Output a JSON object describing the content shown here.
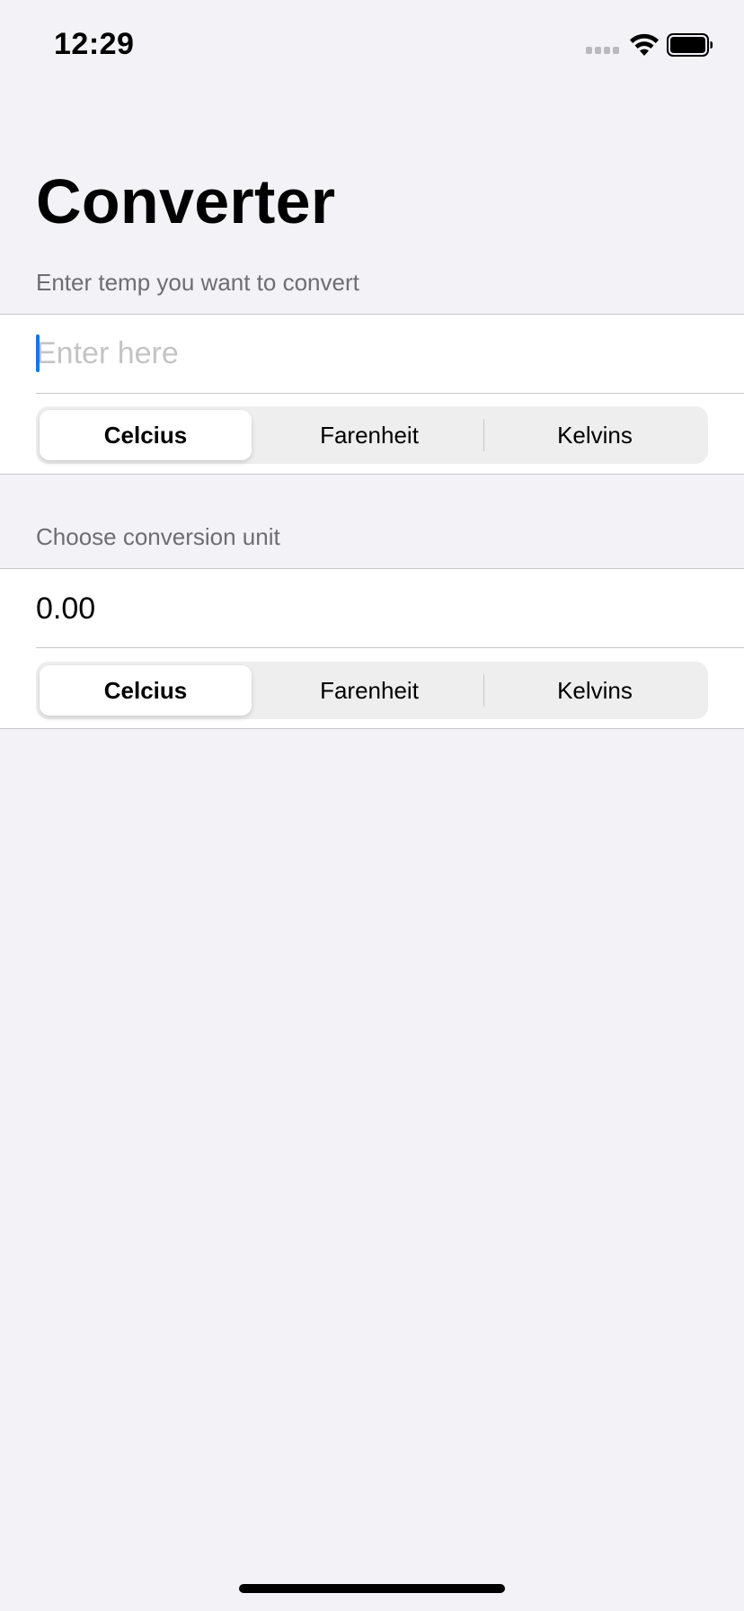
{
  "status_bar": {
    "time": "12:29",
    "icons": [
      "signal-dots-icon",
      "wifi-icon",
      "battery-icon"
    ]
  },
  "title": "Converter",
  "input_section": {
    "header": "Enter temp you want to convert",
    "input_placeholder": "Enter here",
    "input_value": "",
    "units": [
      "Celcius",
      "Farenheit",
      "Kelvins"
    ],
    "selected_unit": "Celcius"
  },
  "output_section": {
    "header": "Choose conversion unit",
    "result": "0.00",
    "units": [
      "Celcius",
      "Farenheit",
      "Kelvins"
    ],
    "selected_unit": "Celcius"
  },
  "colors": {
    "background": "#f2f2f7",
    "cell": "#ffffff",
    "caret": "#1a73e8",
    "secondary_text": "#6d6d72"
  }
}
